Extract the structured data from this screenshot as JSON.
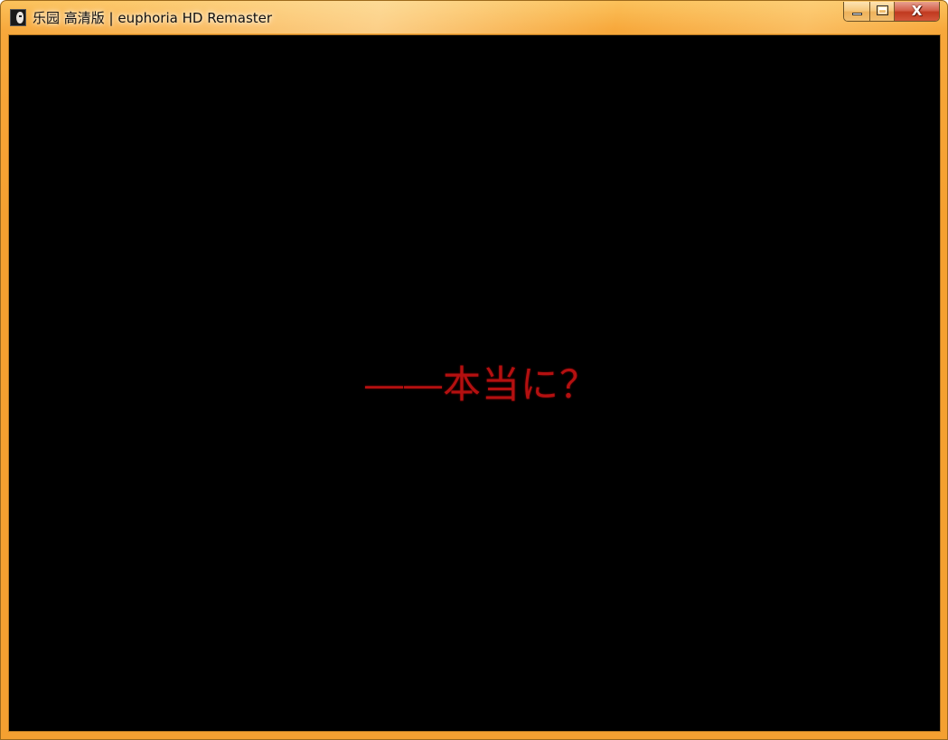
{
  "window": {
    "title": "乐园 高清版 | euphoria HD Remaster",
    "app_icon": "euphoria-app-icon",
    "frame_color": "#f5a030",
    "buttons": {
      "minimize_icon": "minimize-icon",
      "maximize_icon": "maximize-icon",
      "close_label": "X"
    }
  },
  "game": {
    "background_color": "#000000",
    "text": "――本当に？",
    "text_color": "#b41010"
  }
}
